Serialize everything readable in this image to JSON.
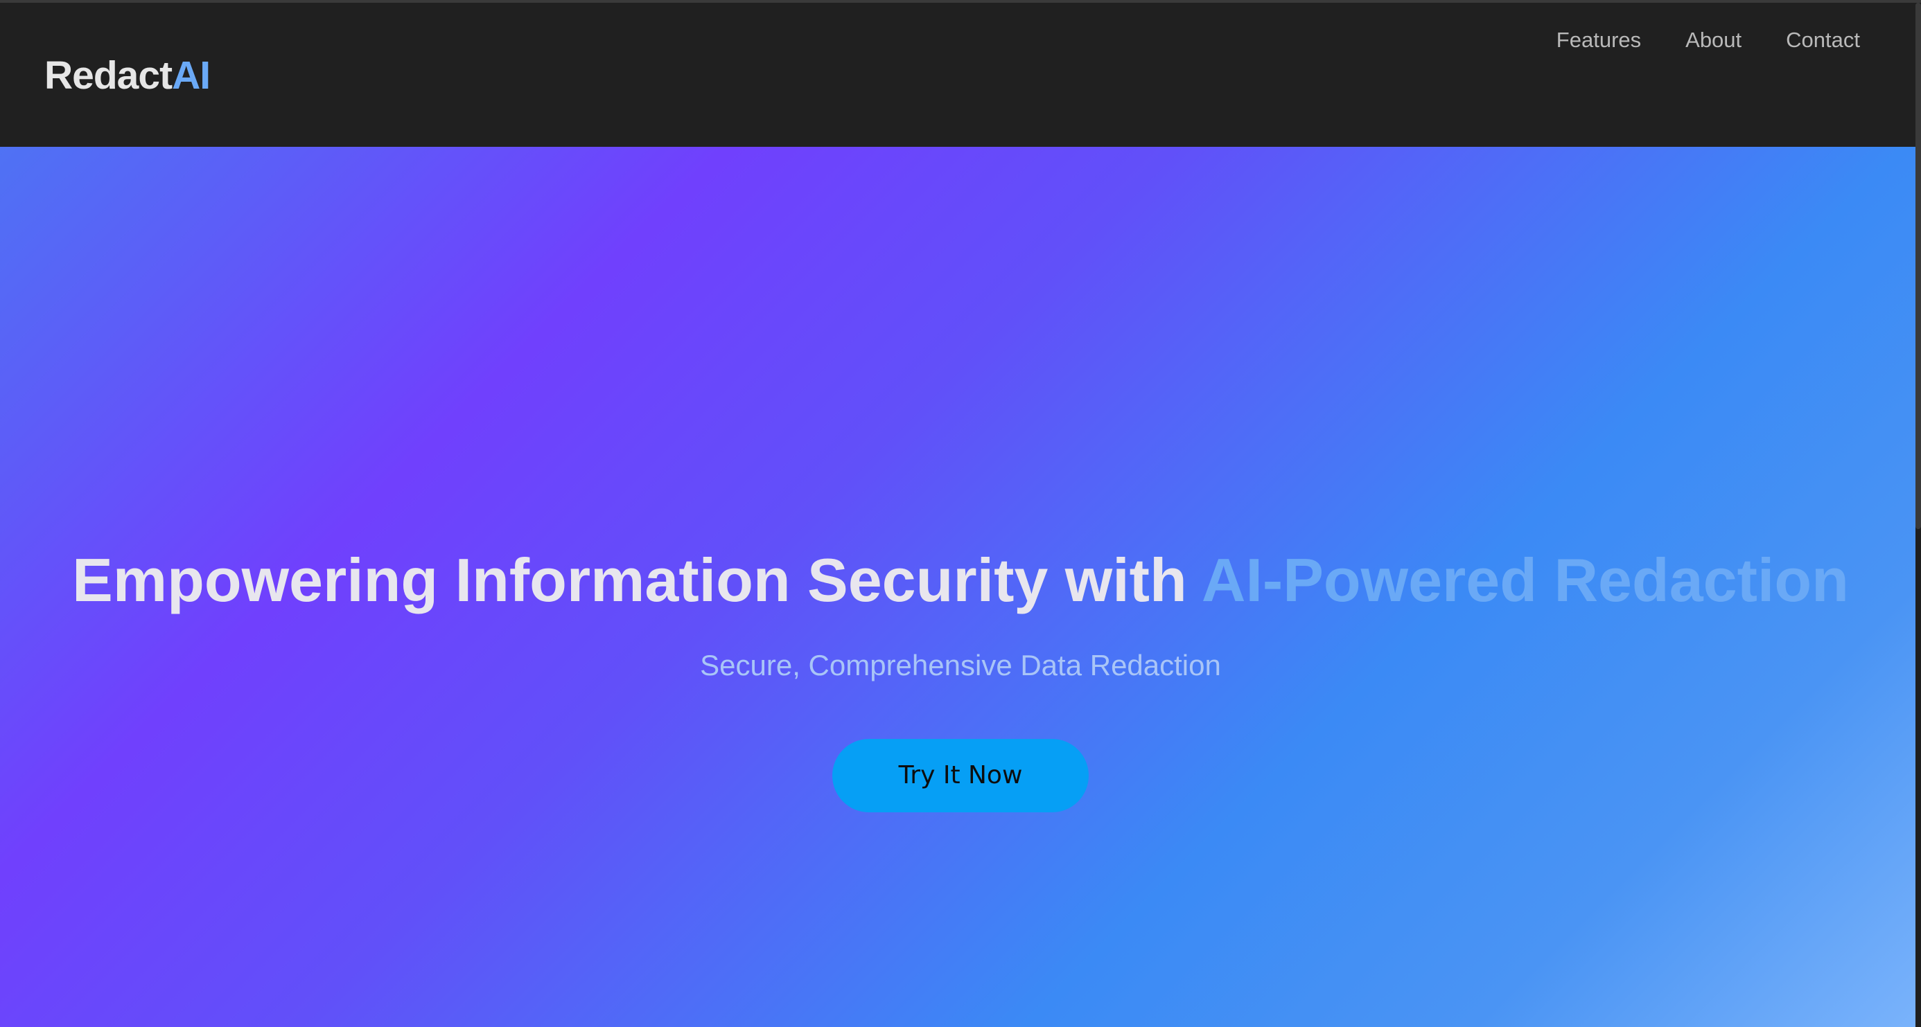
{
  "brand": {
    "name": "Redact",
    "accent": "AI",
    "accent_color": "#6aa9f6"
  },
  "nav": {
    "items": [
      {
        "label": "Features"
      },
      {
        "label": "About"
      },
      {
        "label": "Contact"
      }
    ]
  },
  "hero": {
    "headline_main": "Empowering Information Security with ",
    "headline_accent": "AI-Powered Redaction",
    "subtitle": "Secure, Comprehensive Data Redaction",
    "cta_label": "Try It Now",
    "cta_color": "#069ff5"
  }
}
